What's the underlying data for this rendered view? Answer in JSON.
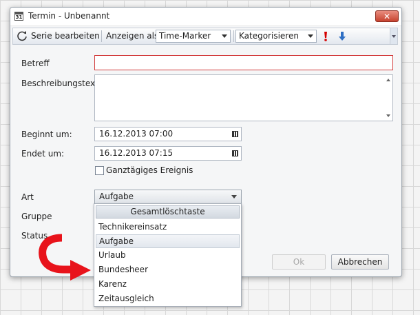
{
  "window": {
    "title": "Termin - Unbenannt",
    "app_icon_text": "31",
    "close_symbol": "✕"
  },
  "toolbar": {
    "edit_series_label": "Serie bearbeiten",
    "show_as_label": "Anzeigen als",
    "show_as_value": "Time-Marker",
    "categorize_label": "Kategorisieren",
    "importance_high_icon": "exclamation-icon",
    "importance_low_icon": "arrow-down-icon"
  },
  "form": {
    "subject_label": "Betreff",
    "description_label": "Beschreibungstext",
    "start_label": "Beginnt um:",
    "start_value": "16.12.2013 07:00",
    "end_label": "Endet um:",
    "end_value": "16.12.2013 07:15",
    "allday_label": "Ganztägiges Ereignis",
    "type_label": "Art",
    "type_value": "Aufgabe",
    "group_label": "Gruppe",
    "status_label": "Status"
  },
  "buttons": {
    "ok_label": "Ok",
    "cancel_label": "Abbrechen"
  },
  "dropdown": {
    "header": "Gesamtlöschtaste",
    "items": [
      {
        "label": "Technikereinsatz"
      },
      {
        "label": "Aufgabe"
      },
      {
        "label": "Urlaub"
      },
      {
        "label": "Bundesheer"
      },
      {
        "label": "Karenz"
      },
      {
        "label": "Zeitausgleich"
      }
    ],
    "selected_index": 1
  },
  "colors": {
    "required_border": "#d23b3b",
    "annotation_arrow": "#e8131b",
    "low_importance_arrow": "#2f6fc4",
    "high_importance": "#d40000"
  }
}
